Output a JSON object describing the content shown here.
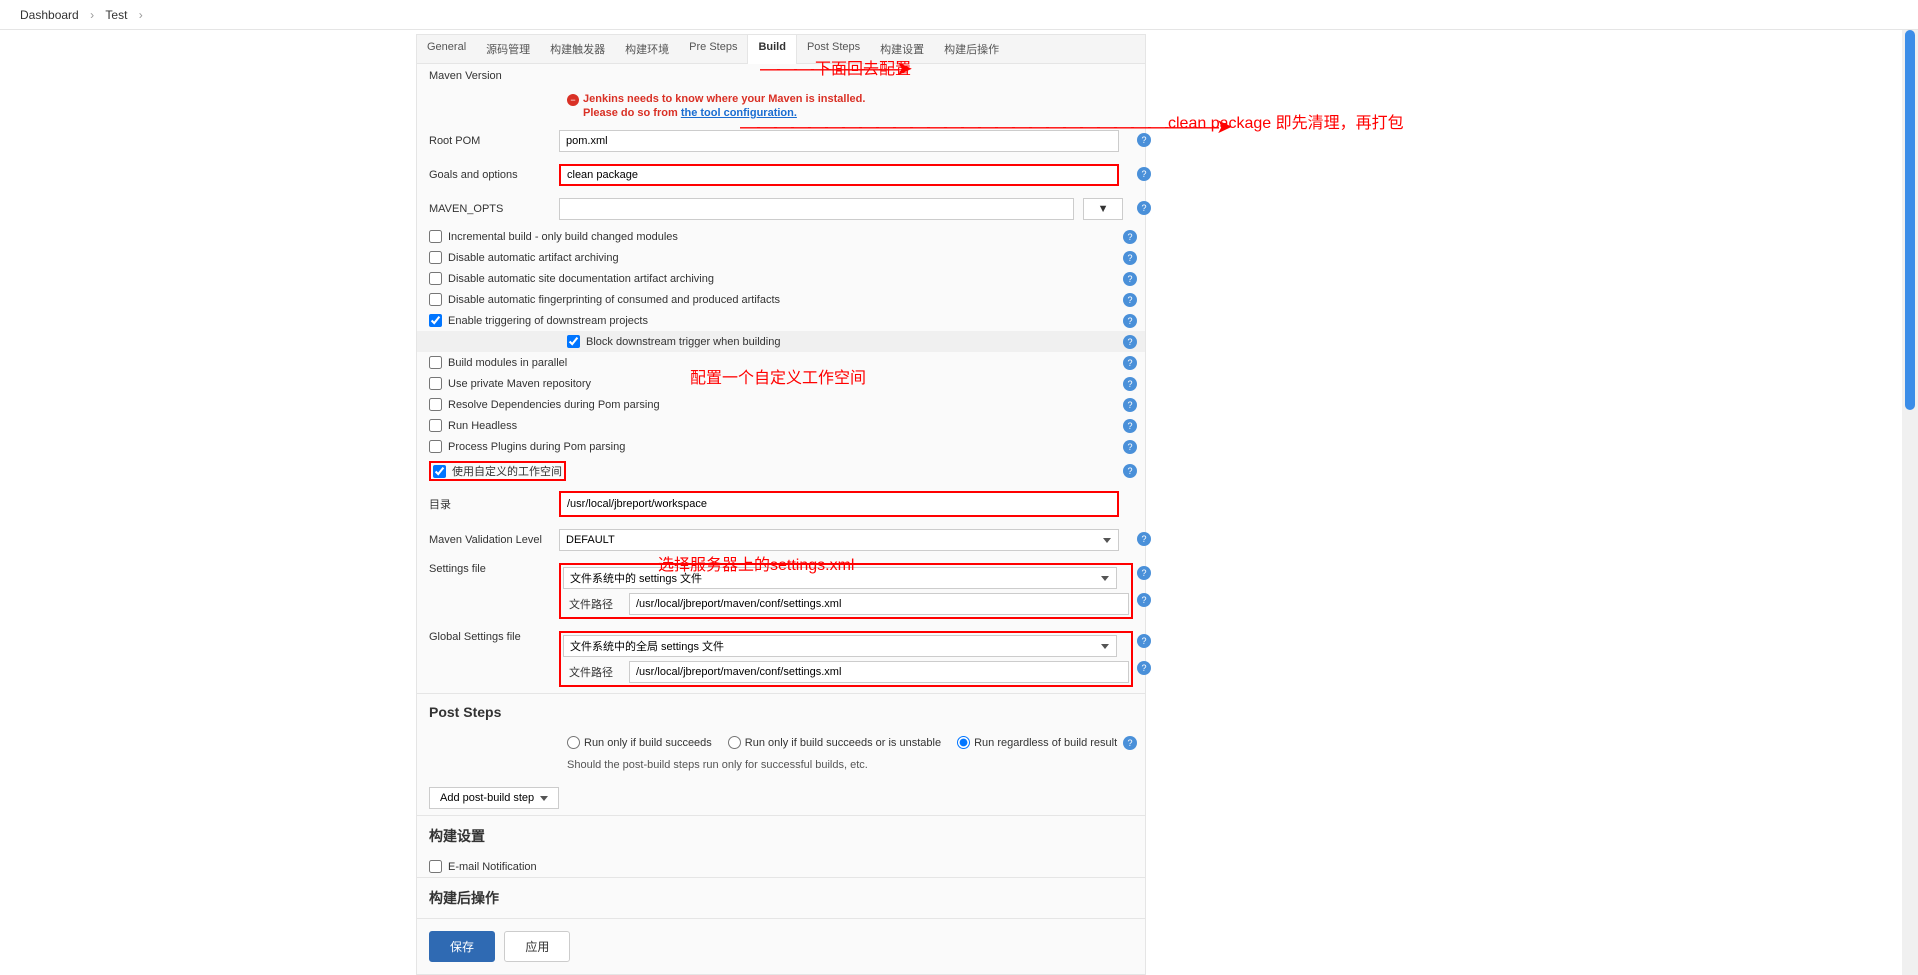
{
  "breadcrumb": {
    "items": [
      "Dashboard",
      "Test"
    ]
  },
  "tabs": [
    "General",
    "源码管理",
    "构建触发器",
    "构建环境",
    "Pre Steps",
    "Build",
    "Post Steps",
    "构建设置",
    "构建后操作"
  ],
  "active_tab": 5,
  "warning": {
    "line1": "Jenkins needs to know where your Maven is installed.",
    "line2_pre": "Please do so from ",
    "line2_link": "the tool configuration.",
    "line2_post": ""
  },
  "fields": {
    "maven_version_label": "Maven Version",
    "root_pom_label": "Root POM",
    "root_pom_value": "pom.xml",
    "goals_label": "Goals and options",
    "goals_value": "clean package",
    "maven_opts_label": "MAVEN_OPTS",
    "maven_opts_value": ""
  },
  "checks": {
    "incremental": "Incremental build - only build changed modules",
    "disable_artifact": "Disable automatic artifact archiving",
    "disable_site": "Disable automatic site documentation artifact archiving",
    "disable_fingerprint": "Disable automatic fingerprinting of consumed and produced artifacts",
    "enable_trigger": "Enable triggering of downstream projects",
    "block_trigger": "Block downstream trigger when building",
    "build_parallel": "Build modules in parallel",
    "private_repo": "Use private Maven repository",
    "resolve_deps": "Resolve Dependencies during Pom parsing",
    "run_headless": "Run Headless",
    "process_plugins": "Process Plugins during Pom parsing",
    "custom_workspace": "使用自定义的工作空间"
  },
  "workspace": {
    "dir_label": "目录",
    "dir_value": "/usr/local/jbreport/workspace"
  },
  "validation": {
    "label": "Maven Validation Level",
    "value": "DEFAULT"
  },
  "settings": {
    "label": "Settings file",
    "select_value": "文件系统中的 settings 文件",
    "path_label": "文件路径",
    "path_value": "/usr/local/jbreport/maven/conf/settings.xml"
  },
  "global_settings": {
    "label": "Global Settings file",
    "select_value": "文件系统中的全局 settings 文件",
    "path_label": "文件路径",
    "path_value": "/usr/local/jbreport/maven/conf/settings.xml"
  },
  "post_steps": {
    "header": "Post Steps",
    "radios": [
      "Run only if build succeeds",
      "Run only if build succeeds or is unstable",
      "Run regardless of build result"
    ],
    "selected": 2,
    "note": "Should the post-build steps run only for successful builds, etc.",
    "add_btn": "Add post-build step"
  },
  "build_settings": {
    "header": "构建设置",
    "email": "E-mail Notification"
  },
  "post_actions": {
    "header": "构建后操作"
  },
  "buttons": {
    "save": "保存",
    "apply": "应用"
  },
  "annotations": {
    "a1": "下面回去配置",
    "a2": "clean package  即先清理，再打包",
    "a3": "配置一个自定义工作空间",
    "a4": "选择服务器上的settings.xml"
  }
}
